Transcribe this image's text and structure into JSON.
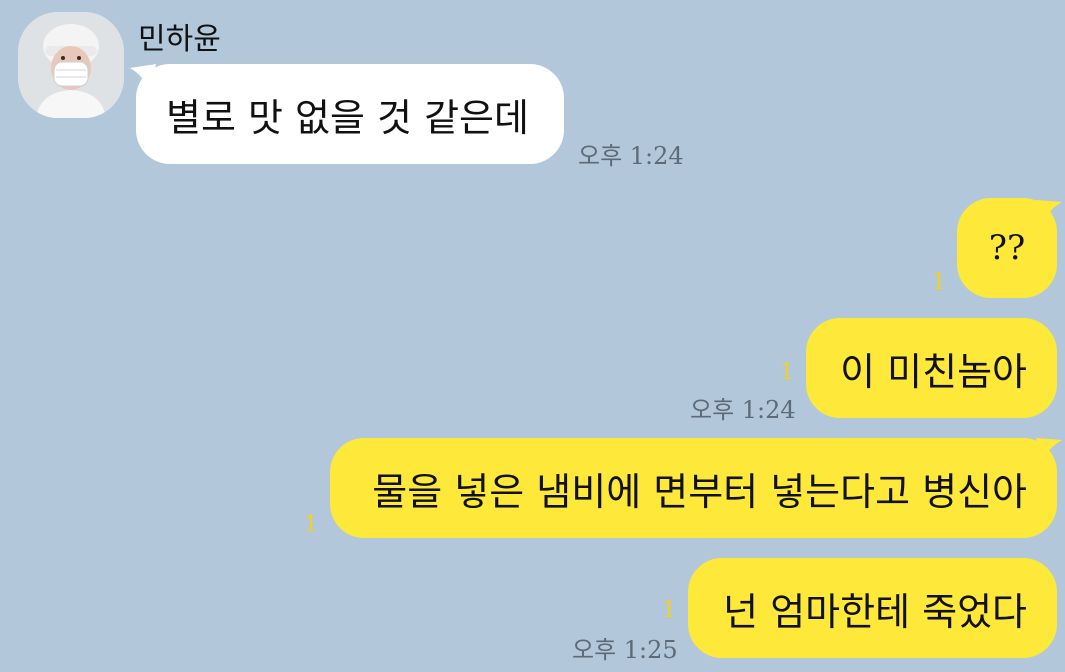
{
  "chat": {
    "sender_name": "민하윤",
    "received": [
      {
        "text": "별로 맛 없을 것 같은데",
        "time": "오후 1:24"
      }
    ],
    "sent": [
      {
        "text": "??",
        "unread": "1",
        "time": ""
      },
      {
        "text": "이 미친놈아",
        "unread": "1",
        "time": "오후 1:24"
      },
      {
        "text": "물을 넣은 냄비에 면부터 넣는다고 병신아",
        "unread": "1",
        "time": ""
      },
      {
        "text": "넌 엄마한테 죽었다",
        "unread": "1",
        "time": "오후 1:25"
      }
    ]
  },
  "colors": {
    "background": "#b2c7da",
    "sent_bubble": "#fee93b",
    "received_bubble": "#ffffff",
    "unread_count": "#f4d21c"
  }
}
